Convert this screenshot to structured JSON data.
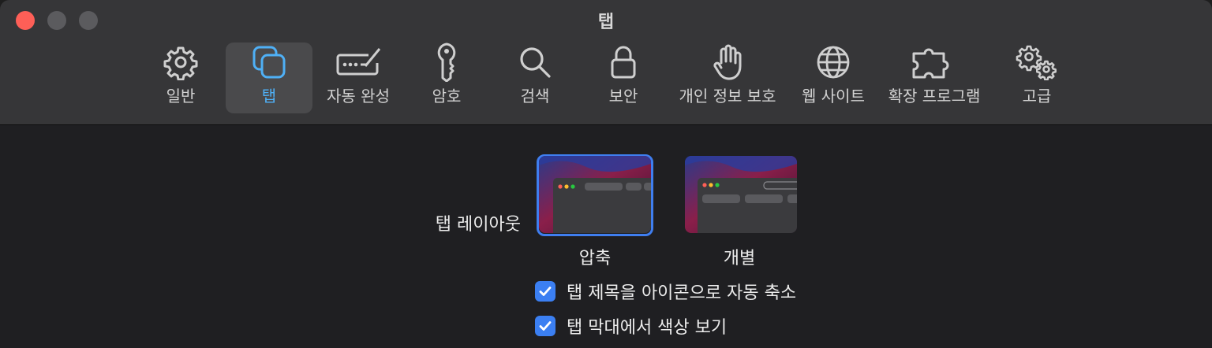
{
  "window": {
    "title": "탭"
  },
  "toolbar": {
    "items": [
      {
        "label": "일반",
        "icon": "gear-icon"
      },
      {
        "label": "탭",
        "icon": "tabs-icon",
        "selected": true
      },
      {
        "label": "자동 완성",
        "icon": "autofill-icon"
      },
      {
        "label": "암호",
        "icon": "key-icon"
      },
      {
        "label": "검색",
        "icon": "search-icon"
      },
      {
        "label": "보안",
        "icon": "lock-icon"
      },
      {
        "label": "개인 정보 보호",
        "icon": "hand-icon"
      },
      {
        "label": "웹 사이트",
        "icon": "globe-icon"
      },
      {
        "label": "확장 프로그램",
        "icon": "puzzle-icon"
      },
      {
        "label": "고급",
        "icon": "gears-icon"
      }
    ]
  },
  "tab_layout": {
    "label": "탭 레이아웃",
    "options": [
      {
        "label": "압축",
        "selected": true
      },
      {
        "label": "개별",
        "selected": false
      }
    ]
  },
  "checkboxes": [
    {
      "label": "탭 제목을 아이콘으로 자동 축소",
      "checked": true
    },
    {
      "label": "탭 막대에서 색상 보기",
      "checked": true
    }
  ],
  "colors": {
    "accent": "#3b7ff2",
    "selected_tab_label": "#4fb0f6",
    "close_button": "#fe5f57"
  }
}
